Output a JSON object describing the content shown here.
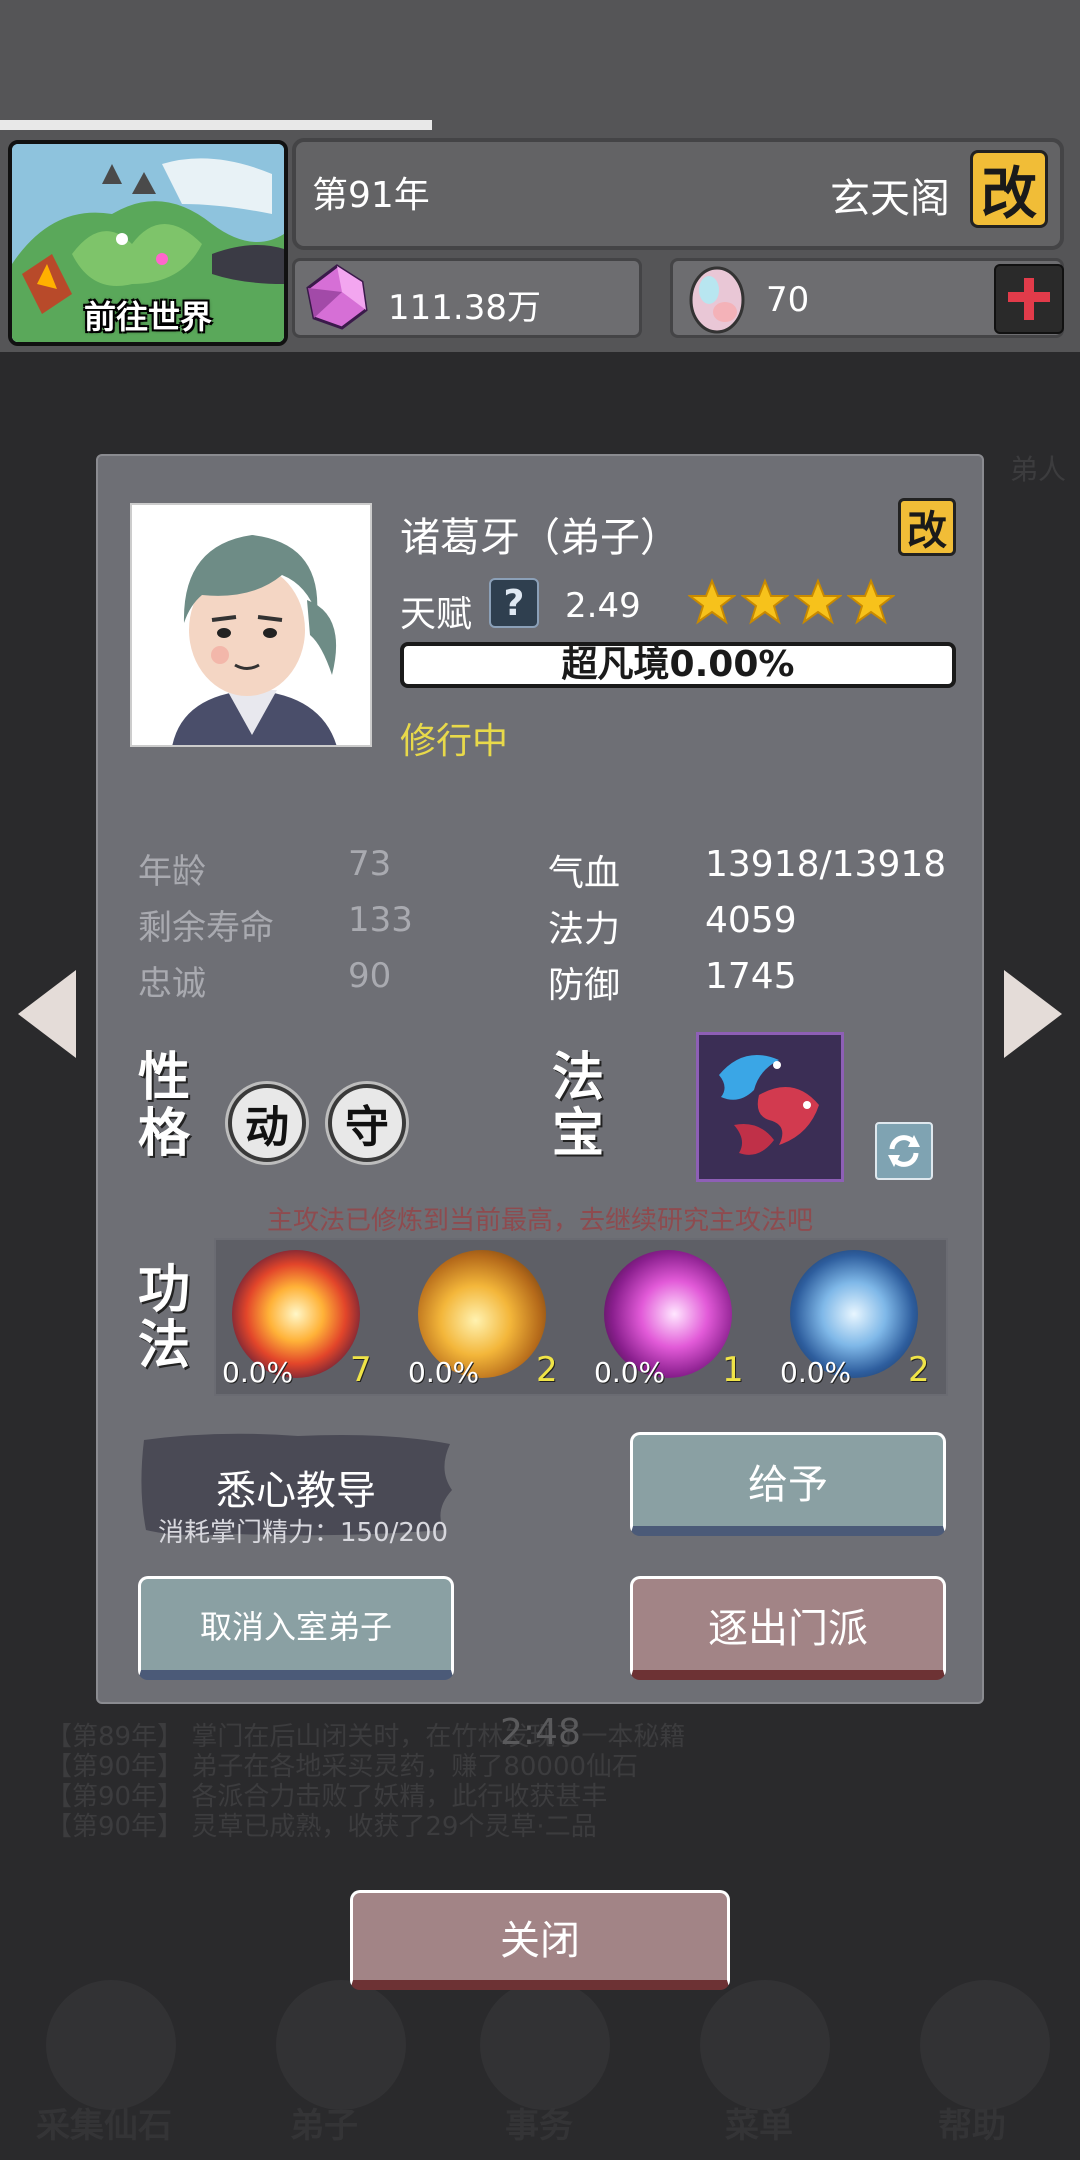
{
  "hud": {
    "world_label": "前往世界",
    "year": "第91年",
    "sect_name": "玄天阁",
    "rename_label": "改",
    "spirit_stones": "111.38万",
    "spirit_eggs": "70"
  },
  "background": {
    "tab_label_partial": "弟人",
    "log": [
      "【第89年】 掌门在后山闭关时，在竹林发现了一本秘籍",
      "【第90年】 弟子在各地采买灵药，赚了80000仙石",
      "【第90年】 各派合力击败了妖精，此行收获甚丰",
      "【第90年】 灵草已成熟，收获了29个灵草·二品"
    ],
    "nav": [
      "采集仙石",
      "弟子",
      "事务",
      "菜单",
      "帮助"
    ]
  },
  "disciple": {
    "name": "诸葛牙（弟子）",
    "rename_label": "改",
    "talent_label": "天赋",
    "talent_help": "?",
    "talent_value": "2.49",
    "stars": 4,
    "realm_text": "超凡境0.00%",
    "realm_progress": 0.0,
    "status": "修行中",
    "stats_left": [
      {
        "label": "年龄",
        "value": "73"
      },
      {
        "label": "剩余寿命",
        "value": "133"
      },
      {
        "label": "忠诚",
        "value": "90"
      }
    ],
    "stats_right": [
      {
        "label": "气血",
        "value": "13918/13918"
      },
      {
        "label": "法力",
        "value": "4059"
      },
      {
        "label": "防御",
        "value": "1745"
      }
    ],
    "personality_label_1": "性",
    "personality_label_2": "格",
    "traits": [
      "动",
      "守"
    ],
    "treasure_label_1": "法",
    "treasure_label_2": "宝",
    "hint": "主攻法已修炼到当前最高，去继续研究主攻法吧",
    "skills_label_1": "功",
    "skills_label_2": "法",
    "skills": [
      {
        "progress": "0.0%",
        "level": "7",
        "icon": "fire-burst-icon"
      },
      {
        "progress": "0.0%",
        "level": "2",
        "icon": "golden-fist-icon"
      },
      {
        "progress": "0.0%",
        "level": "1",
        "icon": "purple-slash-icon"
      },
      {
        "progress": "0.0%",
        "level": "2",
        "icon": "ice-swords-icon"
      }
    ]
  },
  "actions": {
    "teach": "悉心教导",
    "teach_cost": "消耗掌门精力：150/200",
    "give": "给予",
    "cancel_disciple": "取消入室弟子",
    "expel": "逐出门派",
    "close": "关闭"
  },
  "timer": "2:48",
  "colors": {
    "accent_gold": "#f1bd37",
    "status_yellow": "#e8d94a",
    "teal_button": "#8aa0a3",
    "red_button": "#a28486",
    "panel": "#6e6f75"
  }
}
